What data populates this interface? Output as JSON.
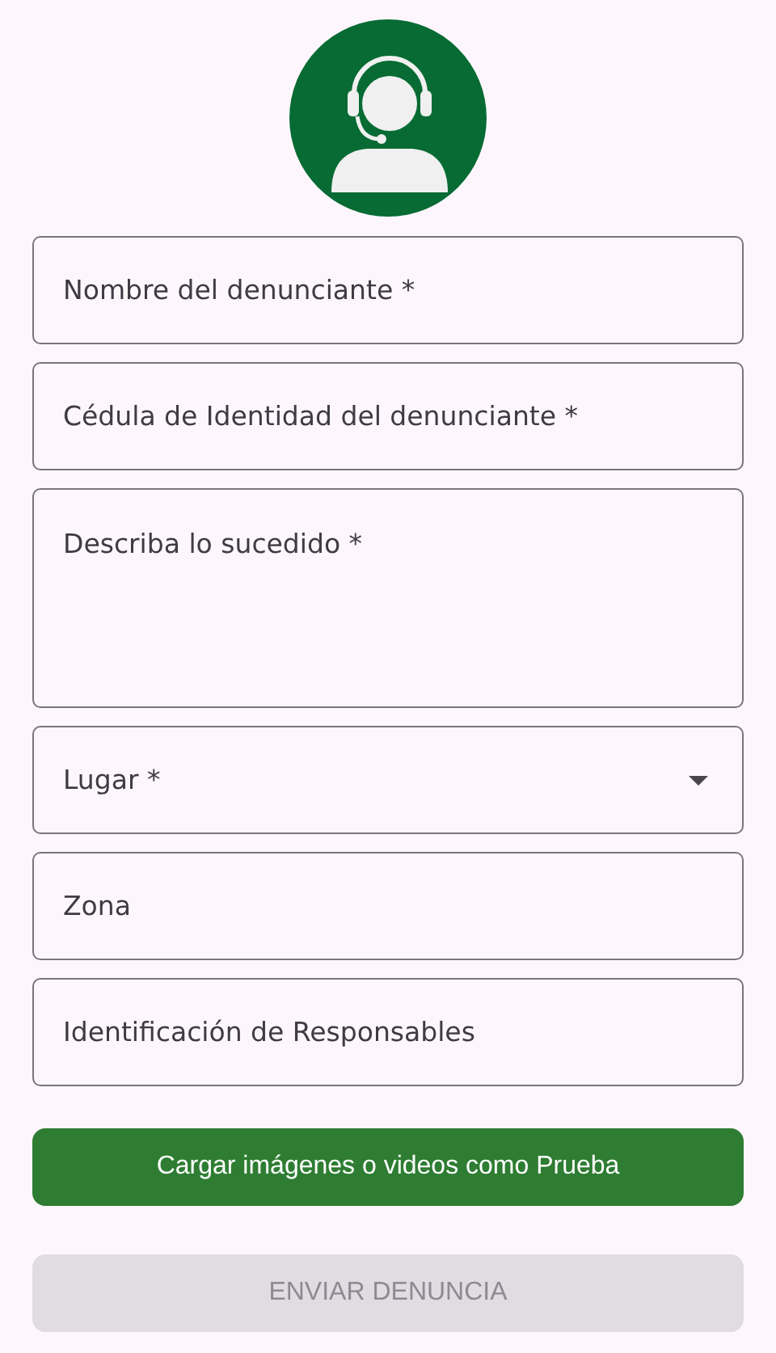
{
  "fields": [
    {
      "kind": "text",
      "placeholder": "Nombre del denunciante *"
    },
    {
      "kind": "text",
      "placeholder": "Cédula de Identidad del denunciante *"
    },
    {
      "kind": "multiline",
      "placeholder": "Describa lo sucedido *"
    },
    {
      "kind": "dropdown",
      "placeholder": "Lugar *"
    },
    {
      "kind": "text",
      "placeholder": "Zona"
    },
    {
      "kind": "text",
      "placeholder": "Identificación de Responsables"
    }
  ],
  "buttons": [
    {
      "label": "Cargar imágenes o videos como Prueba",
      "disabled": false
    },
    {
      "label": "ENVIAR DENUNCIA",
      "disabled": true
    }
  ]
}
